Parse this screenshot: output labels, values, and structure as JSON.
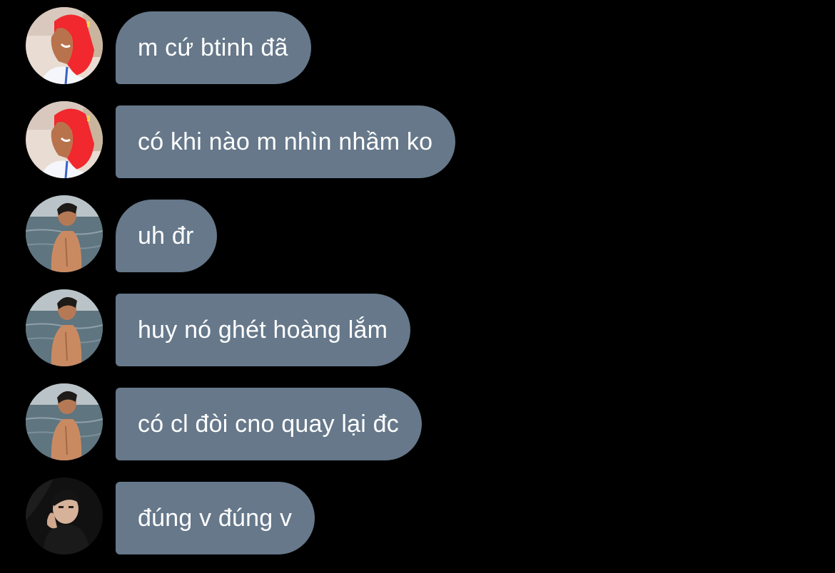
{
  "messages": [
    {
      "sender_avatar": "avatar-red-hood",
      "text": "m cứ btinh đã"
    },
    {
      "sender_avatar": "avatar-red-hood",
      "text": "có khi nào m nhìn nhầm ko"
    },
    {
      "sender_avatar": "avatar-beach-back",
      "text": "uh đr"
    },
    {
      "sender_avatar": "avatar-beach-back",
      "text": "huy nó ghét hoàng lắm"
    },
    {
      "sender_avatar": "avatar-beach-back",
      "text": "có cl đòi cno quay lại đc"
    },
    {
      "sender_avatar": "avatar-dark-portrait",
      "text": "đúng v đúng v"
    }
  ],
  "colors": {
    "background": "#000000",
    "bubble": "#66788a",
    "bubble_text": "#ffffff"
  }
}
